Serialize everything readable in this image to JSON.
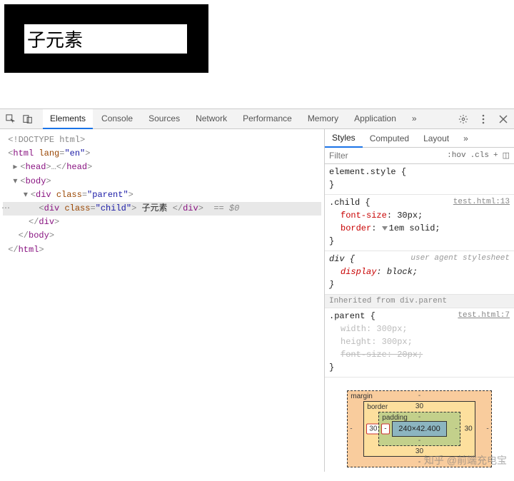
{
  "render": {
    "child_text": "子元素"
  },
  "devtools": {
    "tabs": [
      "Elements",
      "Console",
      "Sources",
      "Network",
      "Performance",
      "Memory",
      "Application"
    ],
    "active_tab": "Elements",
    "more_glyph": "»",
    "dom": {
      "doctype": "<!DOCTYPE html>",
      "html_open_pre": "<",
      "html_tag": "html",
      "lang_attr": "lang",
      "lang_val": "\"en\"",
      "close_gt": ">",
      "head_collapsed_pre": "<",
      "head_tag": "head",
      "ellipsis": "…",
      "head_close": "</head>",
      "body_tag": "body",
      "div_tag": "div",
      "class_attr": "class",
      "parent_val": "\"parent\"",
      "child_val": "\"child\"",
      "child_text": " 子元素 ",
      "div_close": "</div>",
      "body_close": "</body>",
      "html_close": "</html>",
      "eq0": "== $0"
    },
    "styles": {
      "tabs": [
        "Styles",
        "Computed",
        "Layout"
      ],
      "active": "Styles",
      "more": "»",
      "filter_placeholder": "Filter",
      "hov": ":hov",
      "cls": ".cls",
      "plus": "+",
      "toggle": "◫",
      "element_style_sel": "element.style",
      "brace_open": " {",
      "brace_close": "}",
      "child_sel": ".child",
      "child_link": "test.html:13",
      "child_props": [
        {
          "n": "font-size",
          "v": "30px;"
        },
        {
          "n": "border",
          "v": "1em solid;",
          "tri": true
        }
      ],
      "div_sel": "div",
      "ua_label": "user agent stylesheet",
      "div_props": [
        {
          "n": "display",
          "v": "block;",
          "italic": true
        }
      ],
      "inherited_label": "Inherited from ",
      "inherited_sel": "div.parent",
      "parent_sel": ".parent",
      "parent_link": "test.html:7",
      "parent_props": [
        {
          "n": "width",
          "v": "300px;",
          "dim": true
        },
        {
          "n": "height",
          "v": "300px;",
          "dim": true
        },
        {
          "n": "font-size",
          "v": "20px;",
          "dim": true,
          "strike": true
        }
      ]
    },
    "box": {
      "margin_label": "margin",
      "border_label": "border",
      "padding_label": "padding",
      "margin": {
        "t": "-",
        "r": "-",
        "b": "-",
        "l": "-"
      },
      "border": {
        "t": "30",
        "r": "30",
        "b": "30",
        "l": "30"
      },
      "padding": {
        "t": "-",
        "r": "-",
        "b": "-",
        "l": "-"
      },
      "content": "240×42.400"
    }
  },
  "watermark": "知乎 @前端充电宝"
}
